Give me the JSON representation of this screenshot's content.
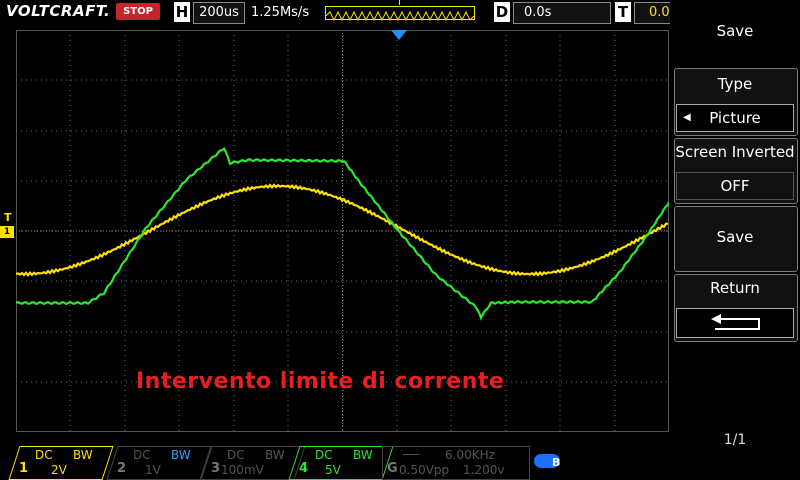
{
  "header": {
    "brand": "VOLTCRAFT.",
    "run_state": "STOP",
    "h_letter": "H",
    "timebase": "200us",
    "sample_rate": "1.25Ms/s",
    "trigger_marker": "T",
    "d_letter": "D",
    "delay": "0.0s",
    "t_letter": "T",
    "trigger_level": "0.0"
  },
  "overlay": {
    "annotation": "Intervento limite di corrente"
  },
  "markers": {
    "trigger": "T",
    "channel1": "1"
  },
  "menu": {
    "title": "Save",
    "type_label": "Type",
    "type_value": "Picture",
    "screen_inverted_label": "Screen Inverted",
    "screen_inverted_value": "OFF",
    "save_label": "Save",
    "return_label": "Return",
    "page": "1/1"
  },
  "channels": [
    {
      "num": "1",
      "coupling": "DC",
      "bw": "BW",
      "scale": "2V",
      "color": "#ffe000",
      "active": true
    },
    {
      "num": "2",
      "coupling": "DC",
      "bw": "BW",
      "scale": "1V",
      "color": "#2aa0ff",
      "active": false
    },
    {
      "num": "3",
      "coupling": "DC",
      "bw": "BW",
      "scale": "100mV",
      "color": "#888888",
      "active": false
    },
    {
      "num": "4",
      "coupling": "DC",
      "bw": "BW",
      "scale": "5V",
      "color": "#2ee62e",
      "active": true
    }
  ],
  "gen": {
    "letter": "G",
    "freq": "6.00KHz",
    "amp": "0.50Vpp",
    "offset": "1.200v"
  },
  "colors": {
    "ch1": "#ffe000",
    "ch4": "#2ee62e",
    "grid": "#6a6a6a",
    "stop": "#c0262c",
    "trigger_arrow": "#1e90ff"
  }
}
